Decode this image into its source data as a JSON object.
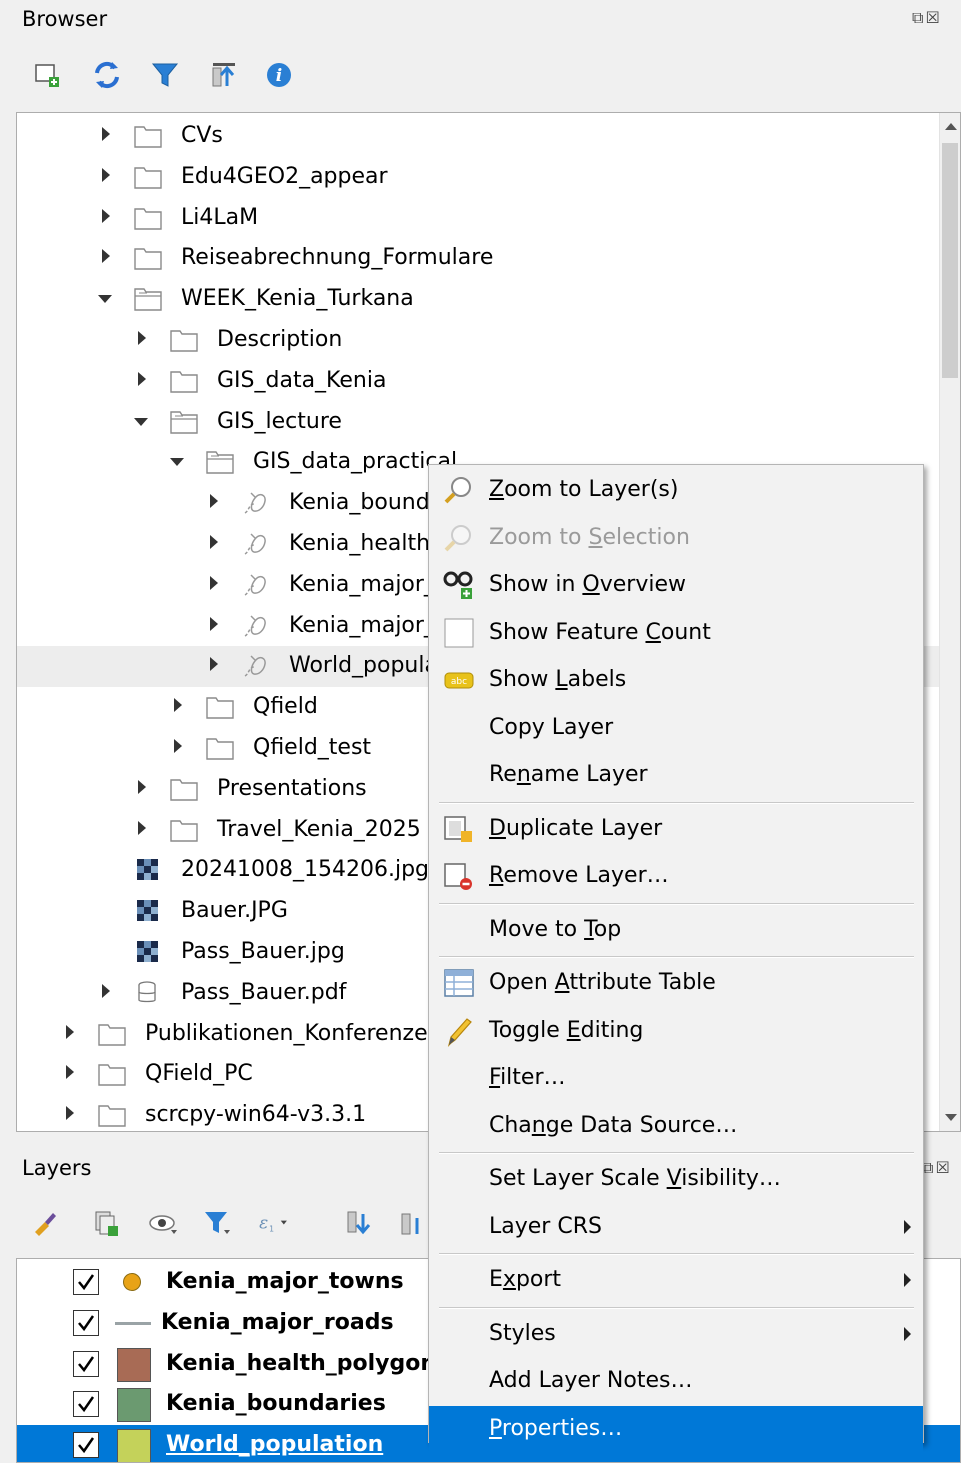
{
  "browser": {
    "title": "Browser",
    "toolbar": [
      "add-layer-icon",
      "refresh-icon",
      "filter-icon",
      "collapse-all-icon",
      "info-icon"
    ],
    "tree": [
      {
        "label": "CVs",
        "type": "folder",
        "level": 0,
        "state": "collapsed"
      },
      {
        "label": "Edu4GEO2_appear",
        "type": "folder",
        "level": 0,
        "state": "collapsed"
      },
      {
        "label": "Li4LaM",
        "type": "folder",
        "level": 0,
        "state": "collapsed"
      },
      {
        "label": "Reiseabrechnung_Formulare",
        "type": "folder",
        "level": 0,
        "state": "collapsed"
      },
      {
        "label": "WEEK_Kenia_Turkana",
        "type": "folder",
        "level": 0,
        "state": "expanded"
      },
      {
        "label": "Description",
        "type": "folder",
        "level": 1,
        "state": "collapsed"
      },
      {
        "label": "GIS_data_Kenia",
        "type": "folder",
        "level": 1,
        "state": "collapsed"
      },
      {
        "label": "GIS_lecture",
        "type": "folder",
        "level": 1,
        "state": "expanded"
      },
      {
        "label": "GIS_data_practical",
        "type": "folder",
        "level": 2,
        "state": "expanded"
      },
      {
        "label": "Kenia_boundaries",
        "type": "vector",
        "level": 3,
        "state": "collapsed"
      },
      {
        "label": "Kenia_health_polygons",
        "type": "vector",
        "level": 3,
        "state": "collapsed"
      },
      {
        "label": "Kenia_major_roads",
        "type": "vector",
        "level": 3,
        "state": "collapsed"
      },
      {
        "label": "Kenia_major_towns",
        "type": "vector",
        "level": 3,
        "state": "collapsed"
      },
      {
        "label": "World_population",
        "type": "vector",
        "level": 3,
        "state": "collapsed",
        "selected": true
      },
      {
        "label": "Qfield",
        "type": "folder",
        "level": 2,
        "state": "collapsed"
      },
      {
        "label": "Qfield_test",
        "type": "folder",
        "level": 2,
        "state": "collapsed"
      },
      {
        "label": "Presentations",
        "type": "folder",
        "level": 1,
        "state": "collapsed"
      },
      {
        "label": "Travel_Kenia_2025",
        "type": "folder",
        "level": 1,
        "state": "collapsed"
      },
      {
        "label": "20241008_154206.jpg",
        "type": "raster",
        "level": 0,
        "state": "none"
      },
      {
        "label": "Bauer.JPG",
        "type": "raster",
        "level": 0,
        "state": "none"
      },
      {
        "label": "Pass_Bauer.jpg",
        "type": "raster",
        "level": 0,
        "state": "none"
      },
      {
        "label": "Pass_Bauer.pdf",
        "type": "database",
        "level": 0,
        "state": "collapsed"
      },
      {
        "label": "Publikationen_Konferenzen",
        "type": "folder",
        "level": -1,
        "state": "collapsed"
      },
      {
        "label": "QField_PC",
        "type": "folder",
        "level": -1,
        "state": "collapsed"
      },
      {
        "label": "scrcpy-win64-v3.3.1",
        "type": "folder",
        "level": -1,
        "state": "collapsed"
      }
    ]
  },
  "layers": {
    "title": "Layers",
    "toolbar": [
      "style-manager-icon",
      "add-group-icon",
      "visibility-icon",
      "filter-legend-icon",
      "expression-filter-icon",
      "expand-all-icon",
      "collapse-all-icon"
    ],
    "items": [
      {
        "name": "Kenia_major_towns",
        "checked": true,
        "symbol": "point",
        "color": "#e8a317"
      },
      {
        "name": "Kenia_major_roads",
        "checked": true,
        "symbol": "line",
        "color": "#9aa3a6"
      },
      {
        "name": "Kenia_health_polygons",
        "checked": true,
        "symbol": "fill",
        "color": "#a86b55"
      },
      {
        "name": "Kenia_boundaries",
        "checked": true,
        "symbol": "fill",
        "color": "#6b9a70"
      },
      {
        "name": "World_population",
        "checked": true,
        "symbol": "fill",
        "color": "#c4d25a",
        "selected": true
      }
    ]
  },
  "context_menu": {
    "items": [
      {
        "label": "Zoom to Layer(s)",
        "u": "Z",
        "icon": "zoom-layer-icon"
      },
      {
        "label": "Zoom to Selection",
        "u": "S",
        "icon": "zoom-selection-icon",
        "disabled": true
      },
      {
        "label": "Show in Overview",
        "u": "O",
        "icon": "overview-icon"
      },
      {
        "label": "Show Feature Count",
        "u": "C",
        "icon": "checkbox-icon"
      },
      {
        "label": "Show Labels",
        "u": "L",
        "icon": "labels-icon"
      },
      {
        "label": "Copy Layer",
        "u": ""
      },
      {
        "label": "Rename Layer",
        "u": "n"
      },
      {
        "sep": true
      },
      {
        "label": "Duplicate Layer",
        "u": "D",
        "icon": "duplicate-layer-icon"
      },
      {
        "label": "Remove Layer…",
        "u": "R",
        "icon": "remove-layer-icon"
      },
      {
        "sep": true
      },
      {
        "label": "Move to Top",
        "u": "T"
      },
      {
        "sep": true
      },
      {
        "label": "Open Attribute Table",
        "u": "A",
        "icon": "attribute-table-icon"
      },
      {
        "label": "Toggle Editing",
        "u": "E",
        "icon": "pencil-icon"
      },
      {
        "label": "Filter…",
        "u": "F"
      },
      {
        "label": "Change Data Source…",
        "u": "n"
      },
      {
        "sep": true
      },
      {
        "label": "Set Layer Scale Visibility…",
        "u": "V"
      },
      {
        "label": "Layer CRS",
        "u": "",
        "submenu": true
      },
      {
        "sep": true
      },
      {
        "label": "Export",
        "u": "x",
        "submenu": true
      },
      {
        "sep": true
      },
      {
        "label": "Styles",
        "u": "",
        "submenu": true
      },
      {
        "label": "Add Layer Notes…",
        "u": ""
      },
      {
        "label": "Properties…",
        "u": "P",
        "highlighted": true
      }
    ]
  },
  "colors": {
    "selection": "#0078d7",
    "folder_stroke": "#8a8a8a",
    "tree_hover": "#ededed"
  }
}
